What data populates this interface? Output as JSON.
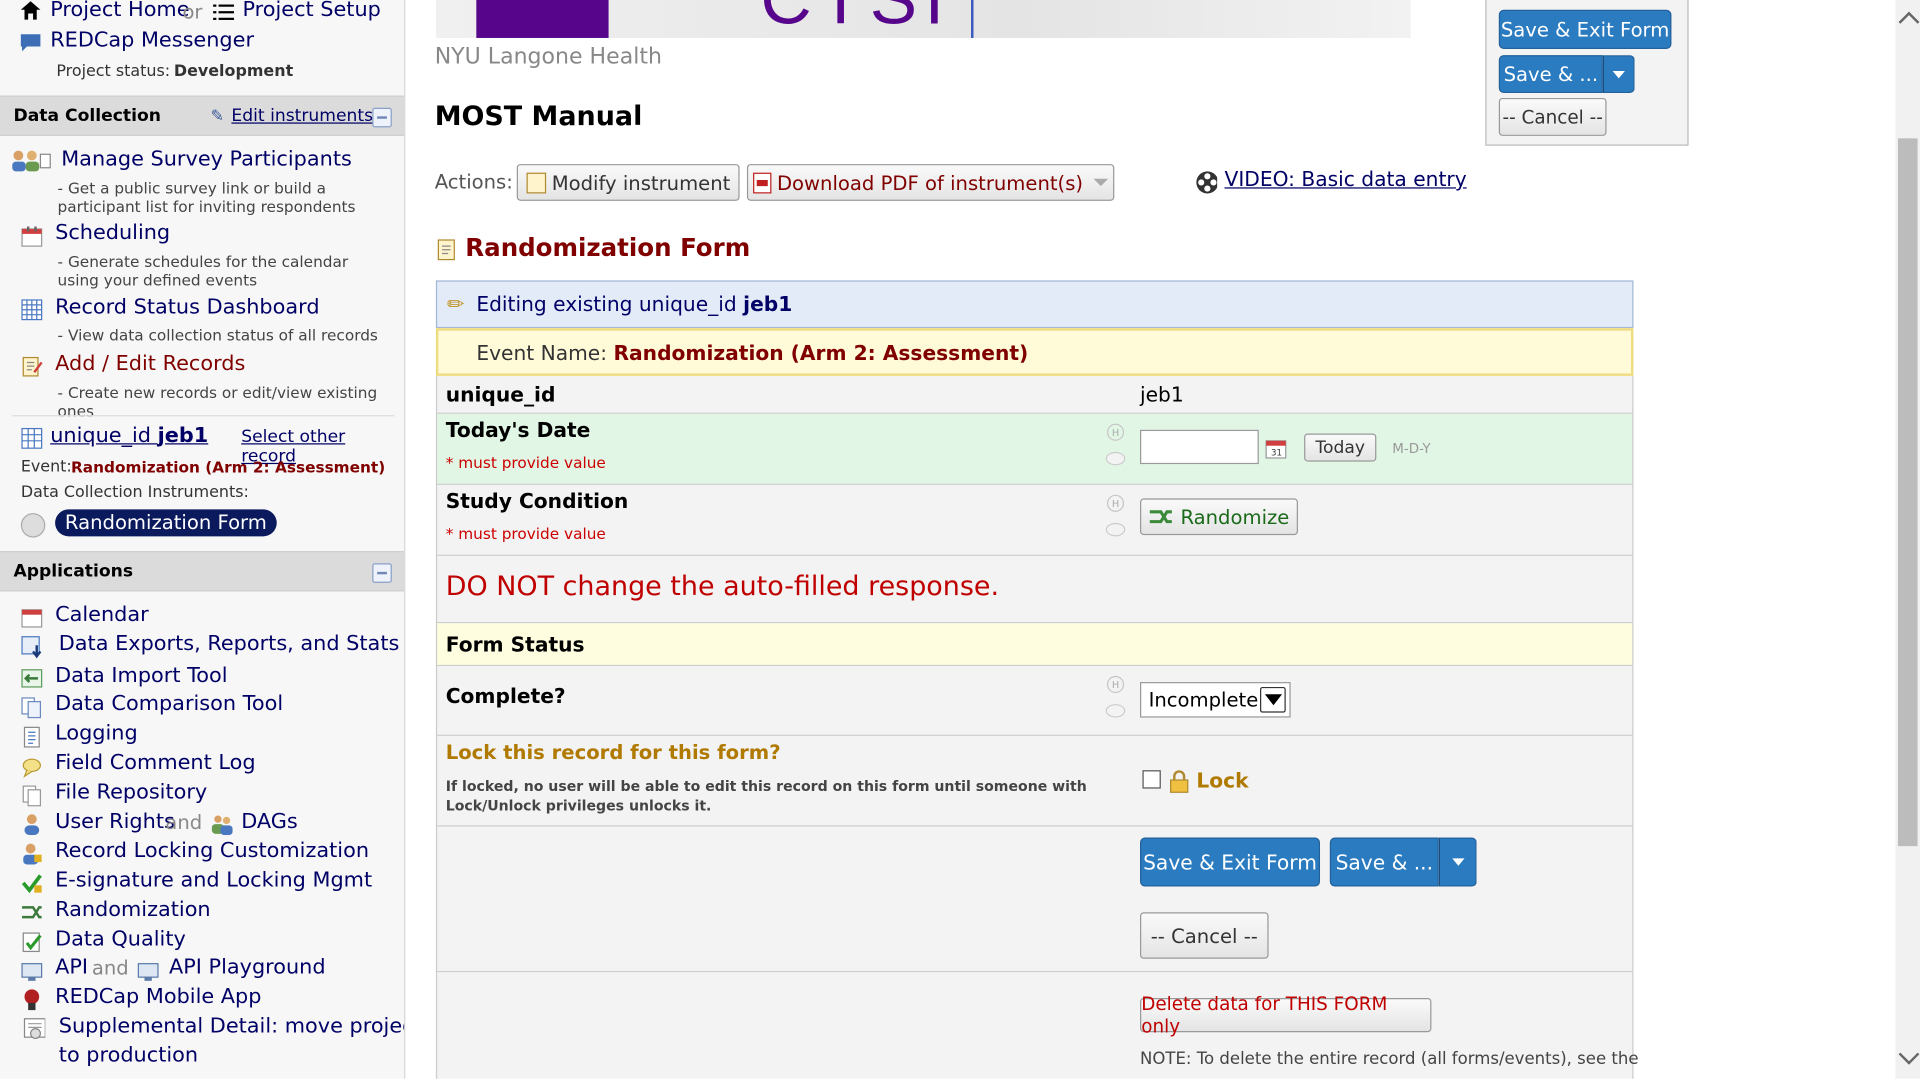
{
  "sidebar": {
    "project_home": "Project Home",
    "or_text": "or",
    "project_setup": "Project Setup",
    "messenger": "REDCap Messenger",
    "status_label": "Project status:",
    "status_value": "Development",
    "data_collection": {
      "title": "Data Collection",
      "edit_instruments": "Edit instruments",
      "items": [
        {
          "label": "Manage Survey Participants",
          "desc": "- Get a public survey link or build a participant list for inviting respondents"
        },
        {
          "label": "Scheduling",
          "desc": "- Generate schedules for the calendar using your defined events"
        },
        {
          "label": "Record Status Dashboard",
          "desc": "- View data collection status of all records"
        },
        {
          "label": "Add / Edit Records",
          "desc": "- Create new records or edit/view existing ones"
        }
      ],
      "record_prefix": "unique_id",
      "record_id": "jeb1",
      "select_other": "Select other record",
      "event_label": "Event:",
      "event_value": "Randomization (Arm 2: Assessment)",
      "instruments_label": "Data Collection Instruments:",
      "instrument": "Randomization Form"
    },
    "applications": {
      "title": "Applications",
      "items": [
        "Calendar",
        "Data Exports, Reports, and Stats",
        "Data Import Tool",
        "Data Comparison Tool",
        "Logging",
        "Field Comment Log",
        "File Repository",
        "User Rights",
        "DAGs",
        "Record Locking Customization",
        "E-signature and Locking Mgmt",
        "Randomization",
        "Data Quality",
        "API",
        "API Playground",
        "REDCap Mobile App",
        "Supplemental Detail: move project",
        "to production"
      ],
      "and_text": "and"
    }
  },
  "header": {
    "logo_text": "CTSI",
    "institution": "NYU Langone Health",
    "project_title": "MOST Manual",
    "actions_label": "Actions:",
    "modify_instrument": "Modify instrument",
    "download_pdf": "Download PDF of instrument(s)",
    "video_link": "VIDEO: Basic data entry"
  },
  "floating": {
    "save_exit": "Save & Exit Form",
    "save_more": "Save & ...",
    "cancel": "-- Cancel --"
  },
  "form": {
    "title": "Randomization Form",
    "editing_prefix": "Editing existing unique_id",
    "editing_id": "jeb1",
    "event_prefix": "Event Name:",
    "event_name": "Randomization (Arm 2: Assessment)",
    "unique_id_label": "unique_id",
    "unique_id_value": "jeb1",
    "todays_date_label": "Today's Date",
    "todays_date_value": "",
    "must_provide": "* must provide value",
    "today_button": "Today",
    "date_format": "M-D-Y",
    "study_condition_label": "Study Condition",
    "randomize_button": "Randomize",
    "warning": "DO NOT change the auto-filled response.",
    "form_status_header": "Form Status",
    "complete_label": "Complete?",
    "complete_value": "Incomplete",
    "lock_title": "Lock this record for this form?",
    "lock_desc": "If locked, no user will be able to edit this record on this form until someone with Lock/Unlock privileges unlocks it.",
    "lock_label": "Lock",
    "save_exit": "Save & Exit Form",
    "save_more": "Save & ...",
    "cancel": "-- Cancel --",
    "delete_button": "Delete data for THIS FORM only",
    "note": "NOTE: To delete the entire record (all forms/events), see the"
  },
  "colors": {
    "navy": "#000066",
    "darkred": "#800000",
    "blue_button": "#2b7bc0",
    "green_row": "#e2f6e6",
    "yellow_row": "#fffde0",
    "red_text": "#c00000",
    "gold": "#b07a00"
  }
}
